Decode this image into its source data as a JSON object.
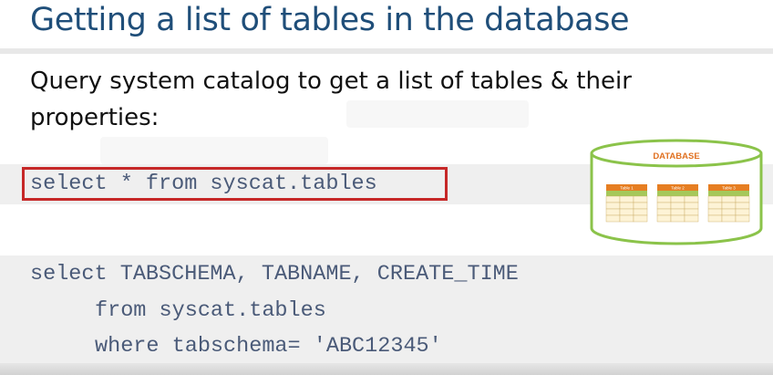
{
  "slide": {
    "title": "Getting a list of tables in the database",
    "subtitle": "Query system catalog to get a list of tables & their properties:"
  },
  "code_block_1": {
    "line1": "select * from syscat.tables"
  },
  "code_block_2": {
    "line1": "select TABSCHEMA, TABNAME, CREATE_TIME",
    "line2": "from syscat.tables",
    "line3": "where tabschema= 'ABC12345'"
  },
  "illustration": {
    "label": "DATABASE",
    "tables": [
      "Table 1",
      "Table 2",
      "Table 3"
    ],
    "colors": {
      "outline": "#8bc34a",
      "label": "#e07020",
      "table_header": "#e67e22",
      "table_cells": "#fdf3d6"
    }
  },
  "colors": {
    "title": "#1f4e79",
    "code": "#4a5a78",
    "highlight_border": "#c62828",
    "code_background": "#efefef"
  }
}
